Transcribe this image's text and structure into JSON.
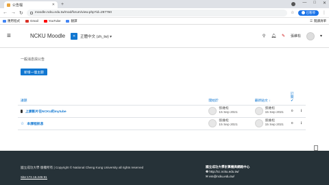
{
  "browser": {
    "tab_title": "公告檔",
    "new_tab": "+",
    "url": "moodle.ncku.edu.tw/mod/forum/view.php?id=297760",
    "profile_status": "已暫停",
    "window_controls": [
      "—",
      "□",
      "✕"
    ]
  },
  "bookmarks": {
    "items": [
      {
        "label": "應用程式",
        "color": "#4285f4"
      },
      {
        "label": "Gmail",
        "color": "#d93025"
      },
      {
        "label": "YouTube",
        "color": "#ff0000"
      },
      {
        "label": "翻譯",
        "color": "#4285f4"
      }
    ],
    "reading_list": "閱讀清單"
  },
  "navbar": {
    "site_name": "NCKU Moodle",
    "language": "正體中文 (zh_tw) ▾",
    "user_name": "張維松"
  },
  "forum": {
    "heading": "一般消息與公告",
    "add_button": "新增一個主題",
    "columns": {
      "discussion": "議題",
      "started_by": "開始於",
      "last_post": "最新貼文 ↓",
      "subscribe": "訂閱"
    },
    "rows": [
      {
        "title": "上課影片在NCKU的mytube",
        "pinned": true,
        "starter_name": "張維松",
        "starter_date": "15 Sep 2021",
        "last_name": "張維松",
        "last_date": "15 Sep 2021",
        "replies": "0"
      },
      {
        "title": "本課程訊息",
        "pinned": false,
        "starter_name": "張維松",
        "starter_date": "15 Sep 2021",
        "last_name": "張維松",
        "last_date": "15 Sep 2021",
        "replies": "0"
      }
    ]
  },
  "footer": {
    "copyright": "國立成功大學 版權所有 | Copyright © National Cheng Kung University all rights reserved",
    "ip": "Site:172.16.249.91",
    "center_name": "國立成功大學計算機與網路中心",
    "center_url": "❷ http://cc.ncku.edu.tw/",
    "center_email": "✉ em@ncku.edu.tw/"
  },
  "colors": {
    "accent": "#1177d1",
    "footer_bg": "#263238"
  }
}
